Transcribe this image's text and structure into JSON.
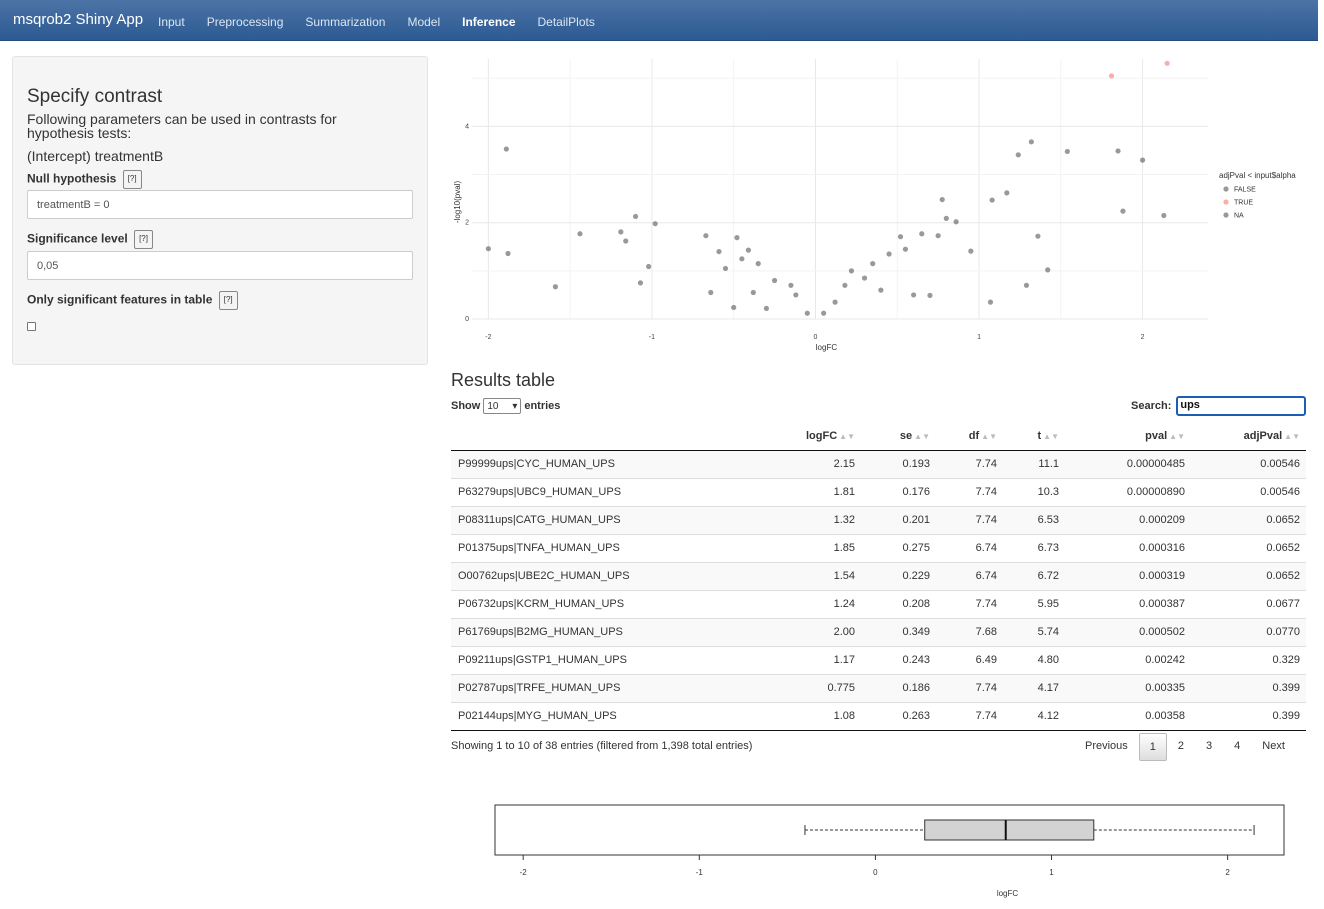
{
  "navbar": {
    "brand": "msqrob2 Shiny App",
    "items": [
      "Input",
      "Preprocessing",
      "Summarization",
      "Model",
      "Inference",
      "DetailPlots"
    ],
    "active": "Inference"
  },
  "sidebar": {
    "title": "Specify contrast",
    "description": "Following parameters can be used in contrasts for hypothesis tests:",
    "parameters": "(Intercept) treatmentB",
    "null_hypothesis": {
      "label": "Null hypothesis",
      "help": "[?]",
      "value": "treatmentB = 0"
    },
    "significance": {
      "label": "Significance level",
      "help": "[?]",
      "value": "0,05"
    },
    "only_significant": {
      "label": "Only significant features in table",
      "help": "[?]",
      "checked": false
    }
  },
  "volcano": {
    "xlabel": "logFC",
    "ylabel": "-log10(pval)",
    "x_ticks": [
      "-2",
      "-1",
      "0",
      "1",
      "2"
    ],
    "y_ticks": [
      "0",
      "2",
      "4"
    ],
    "legend_title": "adjPval < input$alpha",
    "legend_items": [
      {
        "label": "FALSE",
        "color": "#555555"
      },
      {
        "label": "TRUE",
        "color": "#f8766d"
      },
      {
        "label": "NA",
        "color": "#555555"
      }
    ]
  },
  "chart_data": [
    {
      "type": "scatter",
      "xlabel": "logFC",
      "ylabel": "-log10(pval)",
      "xlim": [
        -2.1,
        2.4
      ],
      "ylim": [
        0,
        5.4
      ],
      "series": [
        {
          "name": "TRUE",
          "color": "#f8766d",
          "points": [
            [
              1.81,
              5.05
            ],
            [
              2.15,
              5.31
            ]
          ]
        },
        {
          "name": "FALSE",
          "color": "#555555",
          "points": [
            [
              -1.89,
              3.53
            ],
            [
              -2.0,
              1.46
            ],
            [
              -1.88,
              1.36
            ],
            [
              -1.59,
              0.67
            ],
            [
              -1.44,
              1.77
            ],
            [
              -1.19,
              1.81
            ],
            [
              -1.16,
              1.62
            ],
            [
              -1.1,
              2.13
            ],
            [
              -1.07,
              0.75
            ],
            [
              -1.02,
              1.09
            ],
            [
              -0.98,
              1.98
            ],
            [
              1.32,
              3.68
            ],
            [
              1.24,
              3.41
            ],
            [
              1.54,
              3.48
            ],
            [
              1.85,
              3.49
            ],
            [
              2.0,
              3.3
            ],
            [
              1.17,
              2.62
            ],
            [
              1.08,
              2.47
            ],
            [
              1.88,
              2.24
            ],
            [
              2.13,
              2.15
            ],
            [
              0.775,
              2.48
            ],
            [
              1.36,
              1.72
            ],
            [
              1.42,
              1.02
            ],
            [
              1.29,
              0.7
            ],
            [
              1.07,
              0.35
            ],
            [
              0.95,
              1.41
            ],
            [
              0.8,
              2.09
            ],
            [
              0.86,
              2.02
            ],
            [
              0.75,
              1.73
            ],
            [
              0.65,
              1.77
            ],
            [
              0.52,
              1.71
            ],
            [
              0.7,
              0.49
            ],
            [
              0.6,
              0.5
            ],
            [
              -0.48,
              1.69
            ],
            [
              -0.67,
              1.73
            ],
            [
              -0.59,
              1.4
            ],
            [
              -0.41,
              1.43
            ],
            [
              -0.5,
              0.24
            ],
            [
              -0.64,
              0.55
            ],
            [
              -0.3,
              0.22
            ],
            [
              0.22,
              1.0
            ],
            [
              0.18,
              0.7
            ],
            [
              -0.15,
              0.7
            ],
            [
              -0.12,
              0.5
            ],
            [
              0.12,
              0.35
            ],
            [
              0.05,
              0.12
            ],
            [
              -0.05,
              0.12
            ],
            [
              -0.35,
              1.15
            ],
            [
              0.35,
              1.15
            ],
            [
              -0.25,
              0.8
            ],
            [
              0.3,
              0.85
            ],
            [
              0.45,
              1.35
            ],
            [
              -0.45,
              1.25
            ],
            [
              0.55,
              1.45
            ],
            [
              -0.55,
              1.05
            ],
            [
              0.4,
              0.6
            ],
            [
              -0.38,
              0.55
            ]
          ]
        }
      ]
    },
    {
      "type": "box",
      "xlabel": "logFC",
      "x_ticks": [
        "-2",
        "-1",
        "0",
        "1",
        "2"
      ],
      "xlim": [
        -2.16,
        2.32
      ],
      "whisker_low": -0.4,
      "q1": 0.28,
      "median": 0.74,
      "q3": 1.24,
      "whisker_high": 2.15
    }
  ],
  "results": {
    "title": "Results table",
    "show_label": "Show",
    "page_size": "10",
    "entries_label": "entries",
    "search_label": "Search:",
    "search_value": "ups",
    "columns": [
      "",
      "logFC",
      "se",
      "df",
      "t",
      "pval",
      "adjPval"
    ],
    "rows": [
      [
        "P99999ups|CYC_HUMAN_UPS",
        "2.15",
        "0.193",
        "7.74",
        "11.1",
        "0.00000485",
        "0.00546"
      ],
      [
        "P63279ups|UBC9_HUMAN_UPS",
        "1.81",
        "0.176",
        "7.74",
        "10.3",
        "0.00000890",
        "0.00546"
      ],
      [
        "P08311ups|CATG_HUMAN_UPS",
        "1.32",
        "0.201",
        "7.74",
        "6.53",
        "0.000209",
        "0.0652"
      ],
      [
        "P01375ups|TNFA_HUMAN_UPS",
        "1.85",
        "0.275",
        "6.74",
        "6.73",
        "0.000316",
        "0.0652"
      ],
      [
        "O00762ups|UBE2C_HUMAN_UPS",
        "1.54",
        "0.229",
        "6.74",
        "6.72",
        "0.000319",
        "0.0652"
      ],
      [
        "P06732ups|KCRM_HUMAN_UPS",
        "1.24",
        "0.208",
        "7.74",
        "5.95",
        "0.000387",
        "0.0677"
      ],
      [
        "P61769ups|B2MG_HUMAN_UPS",
        "2.00",
        "0.349",
        "7.68",
        "5.74",
        "0.000502",
        "0.0770"
      ],
      [
        "P09211ups|GSTP1_HUMAN_UPS",
        "1.17",
        "0.243",
        "6.49",
        "4.80",
        "0.00242",
        "0.329"
      ],
      [
        "P02787ups|TRFE_HUMAN_UPS",
        "0.775",
        "0.186",
        "7.74",
        "4.17",
        "0.00335",
        "0.399"
      ],
      [
        "P02144ups|MYG_HUMAN_UPS",
        "1.08",
        "0.263",
        "7.74",
        "4.12",
        "0.00358",
        "0.399"
      ]
    ],
    "info": "Showing 1 to 10 of 38 entries (filtered from 1,398 total entries)",
    "pagination": {
      "previous": "Previous",
      "pages": [
        "1",
        "2",
        "3",
        "4"
      ],
      "current": "1",
      "next": "Next"
    }
  }
}
